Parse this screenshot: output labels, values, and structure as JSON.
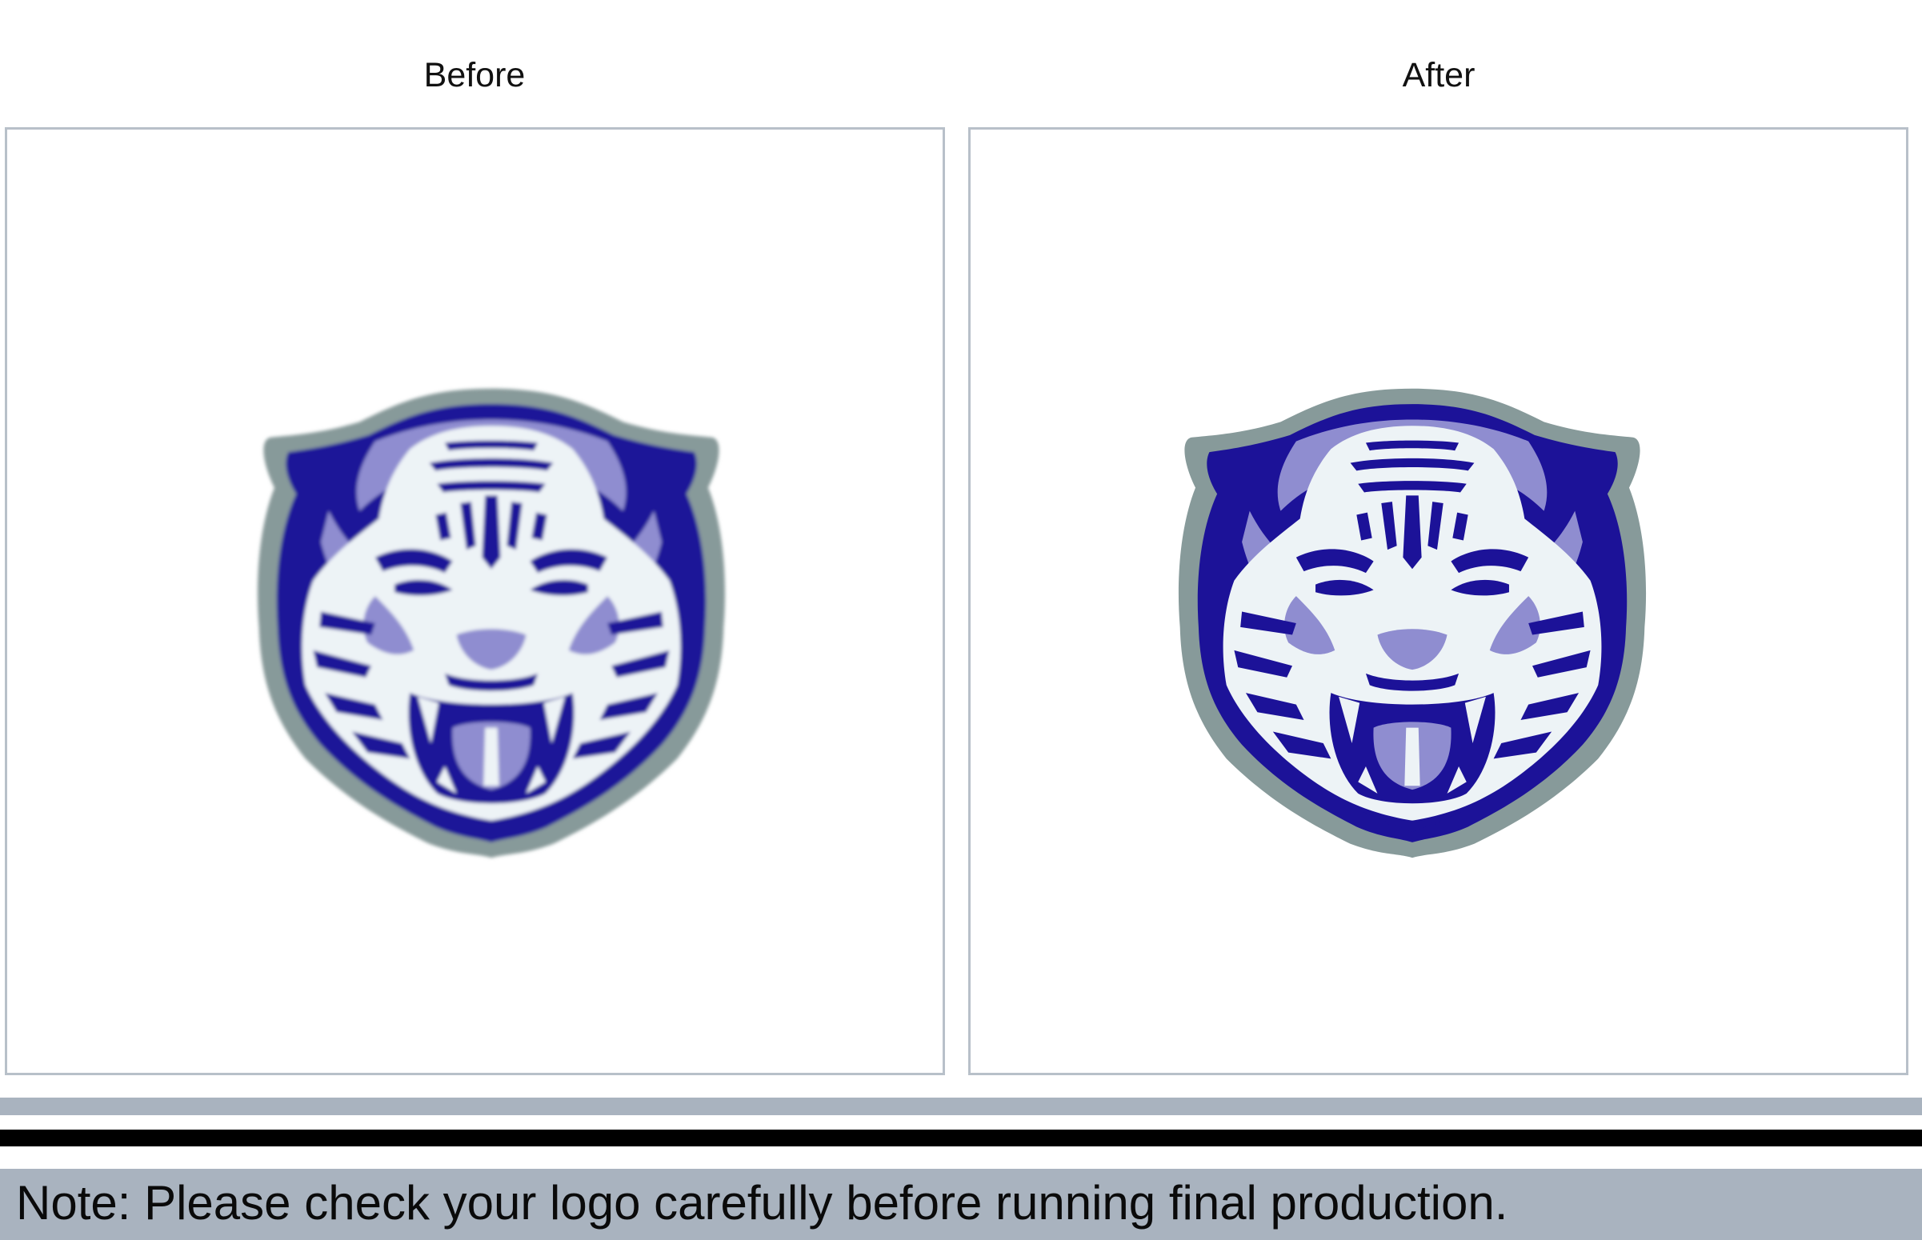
{
  "captions": {
    "before": "Before",
    "after": "After"
  },
  "note": "Note: Please check your logo carefully before running final production.",
  "logos": {
    "before": {
      "icon": "tiger-head-logo",
      "variant": "soft-edges"
    },
    "after": {
      "icon": "tiger-head-logo",
      "variant": "crisp-edges"
    }
  },
  "colors": {
    "logo_outline": "#879a9a",
    "logo_dark": "#1c1298",
    "logo_mid": "#8f8dd0",
    "logo_light": "#edf3f6",
    "panel_border": "#b8c0c9",
    "stripe_gray": "#a9b3bf",
    "stripe_black": "#000000"
  }
}
